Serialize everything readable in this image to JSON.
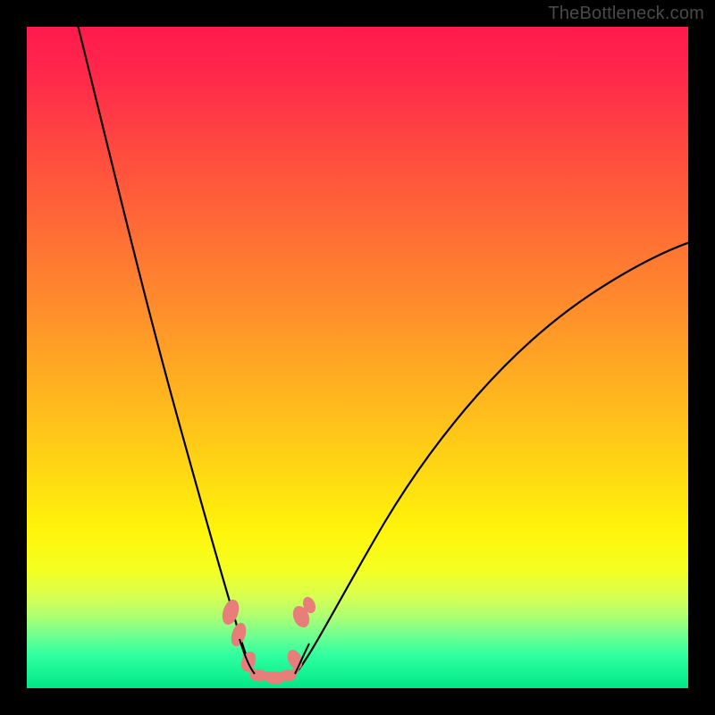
{
  "watermark": "TheBottleneck.com",
  "chart_data": {
    "type": "line",
    "title": "",
    "xlabel": "",
    "ylabel": "",
    "xlim": [
      0,
      100
    ],
    "ylim": [
      0,
      100
    ],
    "grid": false,
    "series": [
      {
        "name": "left-curve",
        "x": [
          9,
          12,
          15,
          18,
          21,
          24,
          26,
          28,
          30,
          31,
          32,
          33
        ],
        "y": [
          100,
          85,
          70,
          55,
          40,
          26,
          16,
          10,
          5,
          3,
          2,
          1
        ]
      },
      {
        "name": "right-curve",
        "x": [
          40,
          42,
          45,
          50,
          55,
          60,
          65,
          70,
          75,
          80,
          85,
          90,
          95,
          100
        ],
        "y": [
          1,
          2,
          5,
          11,
          19,
          27,
          34,
          41,
          47,
          52,
          57,
          61,
          64,
          67
        ]
      },
      {
        "name": "bottom-valley-outline",
        "x": [
          30,
          32,
          34,
          36,
          38,
          40,
          42
        ],
        "y": [
          10,
          4,
          1,
          0.5,
          1,
          3,
          8
        ]
      }
    ],
    "annotations": [
      {
        "type": "valley-marker",
        "x_range": [
          31,
          42
        ],
        "y": 1
      }
    ],
    "colors": {
      "curve": "#000000",
      "valley_marker": "#e77e7a",
      "gradient_top": "#ff1a4d",
      "gradient_mid": "#ffd414",
      "gradient_bottom": "#00e886"
    }
  }
}
